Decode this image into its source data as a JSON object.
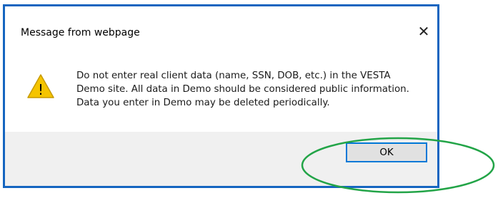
{
  "dialog": {
    "title": "Message from webpage",
    "close_glyph": "✕",
    "icon": "warning-icon",
    "icon_glyph": "!",
    "message": "Do not enter real client data (name, SSN, DOB, etc.) in the VESTA Demo site.  All data in Demo should be considered public information. Data you enter in Demo may be deleted periodically.",
    "ok_label": "OK"
  },
  "colors": {
    "dialog_border": "#1565c0",
    "warning_fill": "#f5c400",
    "highlight_ellipse": "#22a447",
    "button_focus_border": "#0078d7"
  }
}
